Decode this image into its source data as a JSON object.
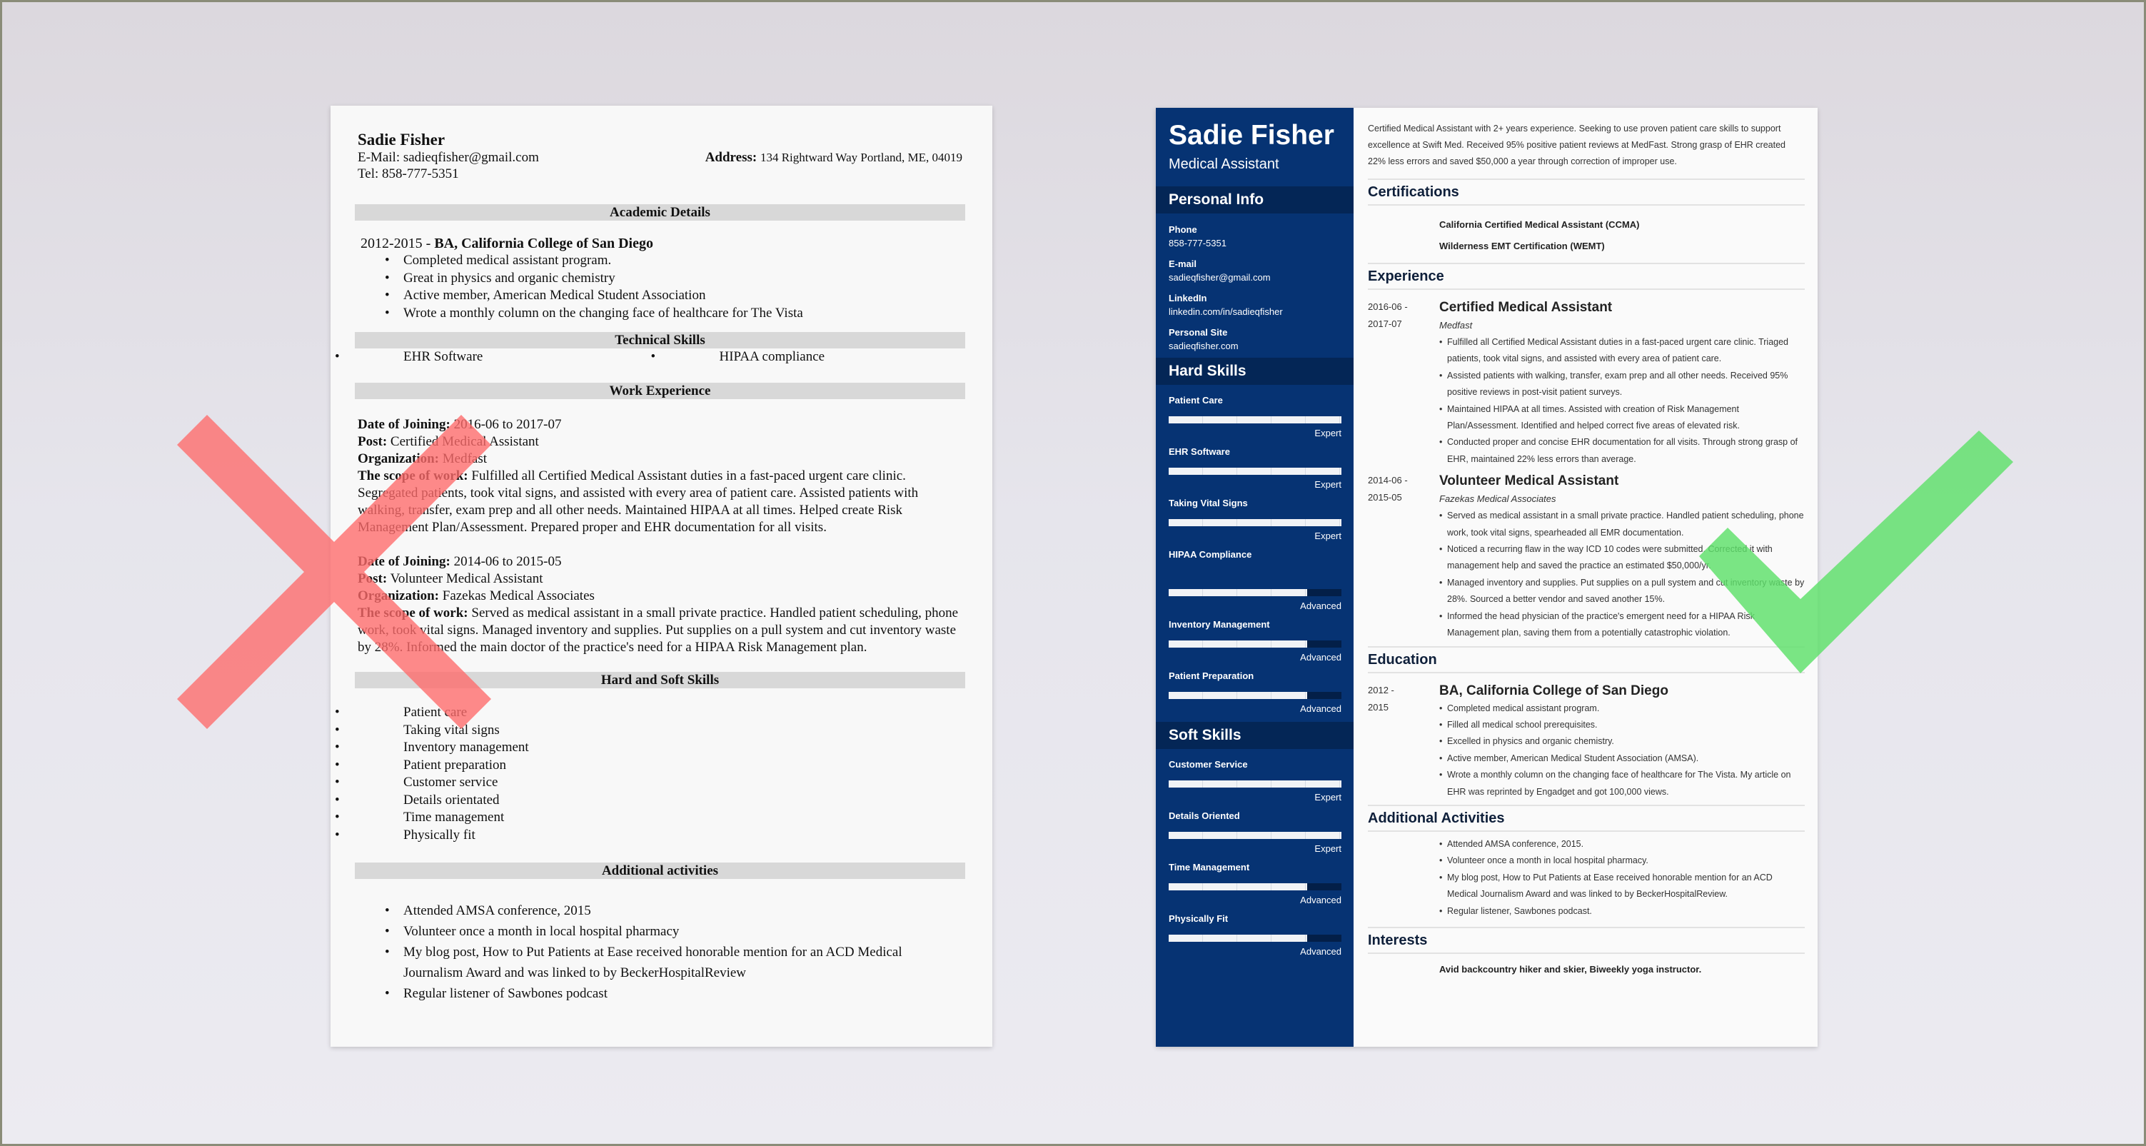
{
  "bad_resume": {
    "name": "Sadie Fisher",
    "email_label": "E-Mail:",
    "email": "sadieqfisher@gmail.com",
    "address_label": "Address:",
    "address": "134 Rightward Way Portland, ME, 04019",
    "tel_label": "Tel:",
    "tel": "858-777-5351",
    "sections": {
      "academic": "Academic Details",
      "technical": "Technical Skills",
      "work": "Work Experience",
      "skills": "Hard and Soft Skills",
      "activities": "Additional activities"
    },
    "education": {
      "years": "2012-2015 - ",
      "degree": "BA, California College of San Diego",
      "bullets": [
        "Completed medical assistant program.",
        "Great in physics and organic chemistry",
        "Active member, American Medical Student Association",
        "Wrote a monthly column on the changing face of healthcare for The Vista"
      ]
    },
    "technical_skills": [
      "EHR Software",
      "HIPAA compliance"
    ],
    "labels": {
      "date": "Date of Joining:",
      "post": "Post:",
      "org": "Organization:",
      "scope": "The scope of work:"
    },
    "jobs": [
      {
        "date": "2016-06 to 2017-07",
        "post": "Certified Medical Assistant",
        "org": "Medfast",
        "scope": "Fulfilled all Certified Medical Assistant duties in a fast-paced urgent care clinic. Segregated patients, took vital signs, and assisted with every area of patient care. Assisted patients with walking, transfer, exam prep and all other needs. Maintained HIPAA at all times. Helped create Risk Management Plan/Assessment. Prepared proper and EHR documentation for all visits."
      },
      {
        "date": "2014-06 to 2015-05",
        "post": "Volunteer Medical Assistant",
        "org": "Fazekas Medical Associates",
        "scope": "Served as medical assistant in a small private practice. Handled patient scheduling, phone work, took vital signs. Managed inventory and supplies. Put supplies on a pull system and cut inventory waste by 28%. Informed the main doctor of the practice's need for a HIPAA Risk Management plan."
      }
    ],
    "skills": [
      "Patient care",
      "Taking vital signs",
      "Inventory management",
      "Patient preparation",
      "Customer service",
      "Details orientated",
      "Time management",
      "Physically fit"
    ],
    "activities": [
      "Attended AMSA conference, 2015",
      "Volunteer once a month in local hospital pharmacy",
      "My blog post, How to Put Patients at Ease received honorable mention for an ACD Medical Journalism Award and was linked to by BeckerHospitalReview",
      "Regular listener of Sawbones podcast"
    ]
  },
  "good_resume": {
    "name": "Sadie Fisher",
    "title": "Medical Assistant",
    "colors": {
      "sidebar": "#063373",
      "sidebar_heading": "#042656",
      "heading_text": "#0e1f3a"
    },
    "personal_info": {
      "heading": "Personal Info",
      "items": [
        {
          "label": "Phone",
          "value": "858-777-5351"
        },
        {
          "label": "E-mail",
          "value": "sadieqfisher@gmail.com"
        },
        {
          "label": "LinkedIn",
          "value": "linkedin.com/in/sadieqfisher"
        },
        {
          "label": "Personal Site",
          "value": "sadieqfisher.com"
        }
      ]
    },
    "hard_skills": {
      "heading": "Hard Skills",
      "items": [
        {
          "name": "Patient Care",
          "level": "Expert",
          "fraction": 1.0
        },
        {
          "name": "EHR Software",
          "level": "Expert",
          "fraction": 1.0
        },
        {
          "name": "Taking Vital Signs",
          "level": "Expert",
          "fraction": 1.0
        },
        {
          "name": "HIPAA Compliance",
          "level": "Advanced",
          "fraction": 0.8
        },
        {
          "name": "Inventory Management",
          "level": "Advanced",
          "fraction": 0.8
        },
        {
          "name": "Patient Preparation",
          "level": "Advanced",
          "fraction": 0.8
        }
      ]
    },
    "soft_skills": {
      "heading": "Soft Skills",
      "items": [
        {
          "name": "Customer Service",
          "level": "Expert",
          "fraction": 1.0
        },
        {
          "name": "Details Oriented",
          "level": "Expert",
          "fraction": 1.0
        },
        {
          "name": "Time Management",
          "level": "Advanced",
          "fraction": 0.8
        },
        {
          "name": "Physically Fit",
          "level": "Advanced",
          "fraction": 0.8
        }
      ]
    },
    "summary": "Certified Medical Assistant with 2+ years experience. Seeking to use proven patient care skills to support excellence at Swift Med. Received 95% positive patient reviews at MedFast. Strong grasp of EHR created 22% less errors and saved $50,000 a year through correction of improper use.",
    "certifications": {
      "heading": "Certifications",
      "items": [
        "California Certified Medical Assistant (CCMA)",
        "Wilderness EMT Certification (WEMT)"
      ]
    },
    "experience": {
      "heading": "Experience",
      "items": [
        {
          "date_start": "2016-06 -",
          "date_end": "2017-07",
          "title": "Certified Medical Assistant",
          "org": "Medfast",
          "bullets": [
            "Fulfilled all Certified Medical Assistant duties in a fast-paced urgent care clinic. Triaged patients, took vital signs, and assisted with every area of patient care.",
            "Assisted patients with walking, transfer, exam prep and all other needs. Received 95% positive reviews in post-visit patient surveys.",
            "Maintained HIPAA at all times. Assisted with creation of Risk Management Plan/Assessment. Identified and helped correct five areas of elevated risk.",
            "Conducted proper and concise EHR documentation for all visits. Through strong grasp of EHR, maintained 22% less errors than average."
          ]
        },
        {
          "date_start": "2014-06 -",
          "date_end": "2015-05",
          "title": "Volunteer Medical Assistant",
          "org": "Fazekas Medical Associates",
          "bullets": [
            "Served as medical assistant in a small private practice. Handled patient scheduling, phone work, took vital signs, spearheaded all EMR documentation.",
            "Noticed a recurring flaw in the way ICD 10 codes were submitted. Corrected it with management help and saved the practice an estimated $50,000/yr.",
            "Managed inventory and supplies. Put supplies on a pull system and cut inventory waste by 28%. Sourced a better vendor and saved another 15%.",
            "Informed the head physician of the practice's emergent need for a HIPAA Risk Management plan, saving them from a potentially catastrophic violation."
          ]
        }
      ]
    },
    "education": {
      "heading": "Education",
      "date_start": "2012 -",
      "date_end": "2015",
      "degree": "BA, California College of San Diego",
      "bullets": [
        "Completed medical assistant program.",
        "Filled all medical school prerequisites.",
        "Excelled in physics and organic chemistry.",
        "Active member, American Medical Student Association (AMSA).",
        "Wrote a monthly column on the changing face of healthcare for The Vista. My article on EHR was reprinted by Engadget and got 100,000 views."
      ]
    },
    "activities": {
      "heading": "Additional Activities",
      "items": [
        "Attended AMSA conference, 2015.",
        "Volunteer once a month in local hospital pharmacy.",
        "My blog post, How to Put Patients at Ease received honorable mention for an ACD Medical Journalism Award and was linked to by BeckerHospitalReview.",
        "Regular listener, Sawbones podcast."
      ]
    },
    "interests": {
      "heading": "Interests",
      "text": "Avid backcountry hiker and skier, Biweekly yoga instructor."
    }
  },
  "marks": {
    "wrong": {
      "icon": "x-mark-icon",
      "color": "#ff6b6b"
    },
    "right": {
      "icon": "check-mark-icon",
      "color": "#5ee06a"
    }
  }
}
